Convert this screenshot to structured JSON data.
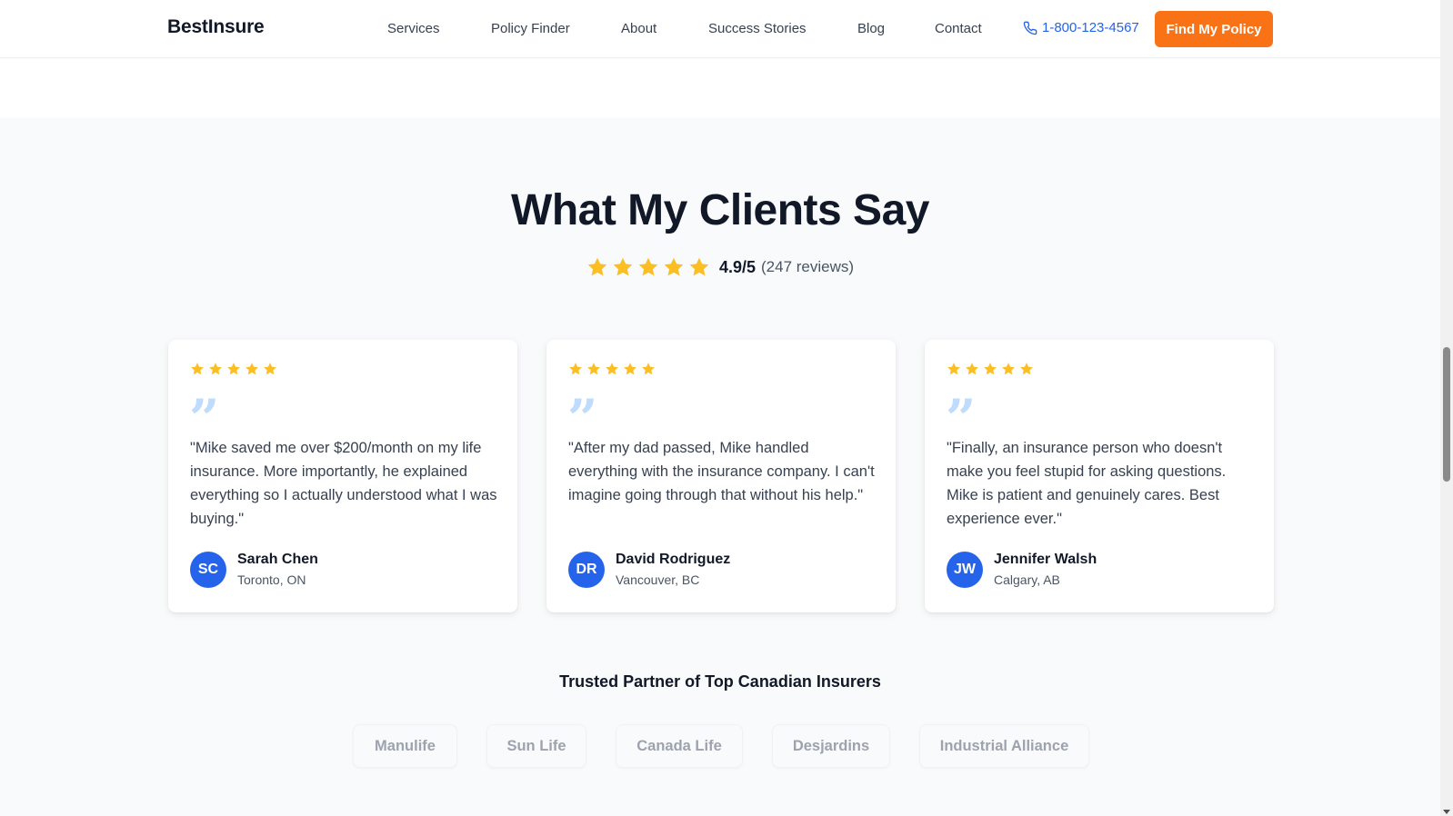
{
  "header": {
    "logo": "BestInsure",
    "nav": [
      "Services",
      "Policy Finder",
      "About",
      "Success Stories",
      "Blog",
      "Contact"
    ],
    "phone": "1-800-123-4567",
    "cta": "Find My Policy"
  },
  "testimonials": {
    "title": "What My Clients Say",
    "rating_score": "4.9/5",
    "rating_count": "(247 reviews)",
    "stars": 5,
    "cards": [
      {
        "stars": 5,
        "quote": "\"Mike saved me over $200/month on my life insurance. More importantly, he explained everything so I actually understood what I was buying.\"",
        "initials": "SC",
        "name": "Sarah Chen",
        "location": "Toronto, ON"
      },
      {
        "stars": 5,
        "quote": "\"After my dad passed, Mike handled everything with the insurance company. I can't imagine going through that without his help.\"",
        "initials": "DR",
        "name": "David Rodriguez",
        "location": "Vancouver, BC"
      },
      {
        "stars": 5,
        "quote": "\"Finally, an insurance person who doesn't make you feel stupid for asking questions. Mike is patient and genuinely cares. Best experience ever.\"",
        "initials": "JW",
        "name": "Jennifer Walsh",
        "location": "Calgary, AB"
      }
    ]
  },
  "partners": {
    "title": "Trusted Partner of Top Canadian Insurers",
    "names": [
      "Manulife",
      "Sun Life",
      "Canada Life",
      "Desjardins",
      "Industrial Alliance"
    ]
  },
  "colors": {
    "accent": "#f97316",
    "brand_blue": "#2563eb",
    "star": "#fbbf24",
    "quote_icon": "#bfdbfe"
  }
}
